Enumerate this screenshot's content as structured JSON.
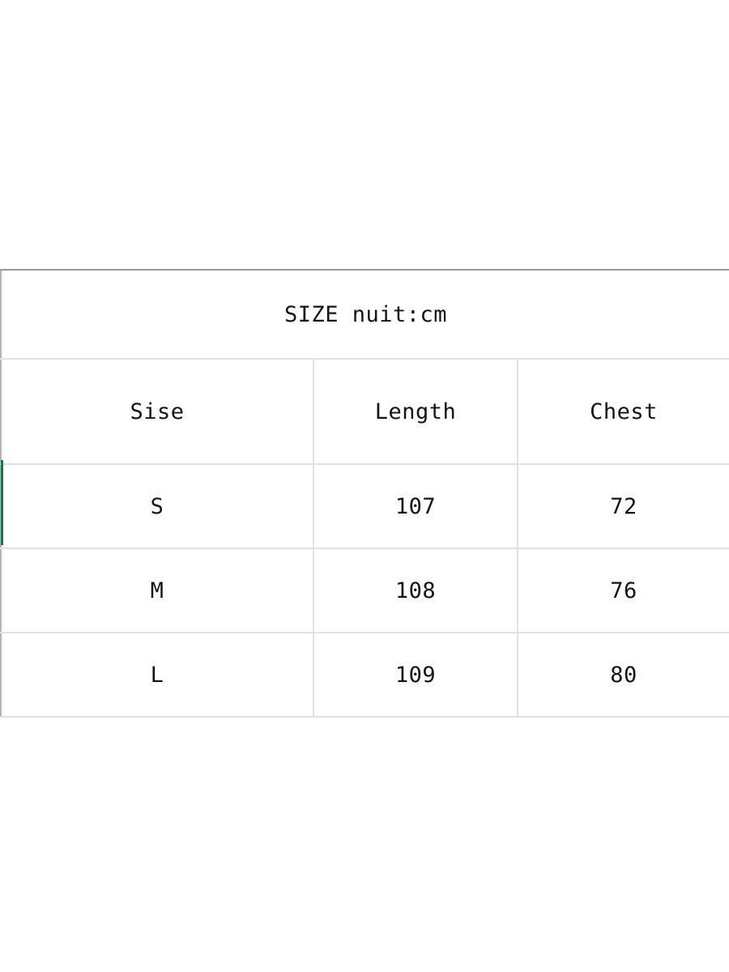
{
  "document": {
    "background_color": "#ffffff",
    "accent_color": "#16794a",
    "border_color_outer": "#9b9b9b",
    "border_color_inner": "#e2e2e2",
    "text_color": "#141414"
  },
  "size_chart": {
    "title": "SIZE nuit:cm",
    "columns": [
      "Sise",
      "Length",
      "Chest"
    ],
    "rows": [
      {
        "size": "S",
        "length": "107",
        "chest": "72"
      },
      {
        "size": "M",
        "length": "108",
        "chest": "76"
      },
      {
        "size": "L",
        "length": "109",
        "chest": "80"
      }
    ]
  },
  "chart_data": {
    "type": "table",
    "title": "SIZE nuit:cm",
    "columns": [
      "Sise",
      "Length",
      "Chest"
    ],
    "rows": [
      [
        "S",
        "107",
        "72"
      ],
      [
        "M",
        "108",
        "76"
      ],
      [
        "L",
        "109",
        "80"
      ]
    ],
    "units": "cm"
  }
}
